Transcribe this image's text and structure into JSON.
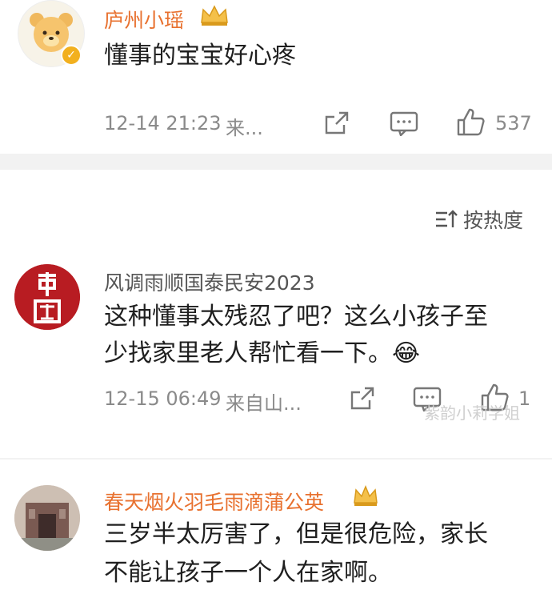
{
  "comments": [
    {
      "username": "庐州小瑶",
      "text_lines": [
        "懂事的宝宝好心疼"
      ],
      "timestamp": "12-14 21:23",
      "source": "来...",
      "likes": "537",
      "username_color": "#e8712f"
    },
    {
      "username": "风调雨顺国泰民安2023",
      "text_lines": [
        "这种懂事太残忍了吧？这么小孩子至",
        "少找家里老人帮忙看一下。😂"
      ],
      "timestamp": "12-15 06:49",
      "source": "来自山...",
      "likes": "1",
      "username_color": "#555555"
    },
    {
      "username": "春天烟火羽毛雨滴蒲公英",
      "text_lines": [
        "三岁半太厉害了，但是很危险，家长",
        "不能让孩子一个人在家啊。"
      ],
      "username_color": "#e8712f"
    }
  ],
  "sort": {
    "label": "按热度"
  },
  "watermark": "紫韵小莉学姐"
}
